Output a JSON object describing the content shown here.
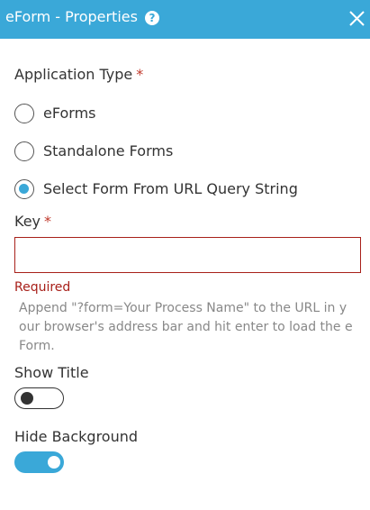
{
  "header": {
    "title": "eForm - Properties",
    "help_icon": "?",
    "background_color": "#3aa8d8"
  },
  "application_type": {
    "label": "Application Type",
    "required_mark": "*",
    "options": [
      {
        "label": "eForms",
        "selected": false
      },
      {
        "label": "Standalone Forms",
        "selected": false
      },
      {
        "label": "Select Form From URL Query String",
        "selected": true
      }
    ]
  },
  "key": {
    "label": "Key",
    "required_mark": "*",
    "value": "",
    "error": "Required",
    "help": "Append \"?form=Your Process Name\" to the URL in your browser's address bar and hit enter to load the eForm."
  },
  "show_title": {
    "label": "Show Title",
    "enabled": false
  },
  "hide_background": {
    "label": "Hide Background",
    "enabled": true
  },
  "colors": {
    "accent": "#3aa8d8",
    "error": "#a8201a"
  }
}
